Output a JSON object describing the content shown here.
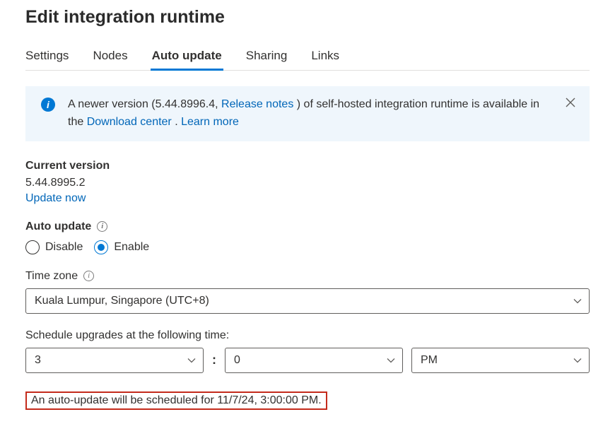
{
  "title": "Edit integration runtime",
  "tabs": [
    {
      "label": "Settings"
    },
    {
      "label": "Nodes"
    },
    {
      "label": "Auto update",
      "active": true
    },
    {
      "label": "Sharing"
    },
    {
      "label": "Links"
    }
  ],
  "banner": {
    "text_part1": "A newer version (5.44.8996.4, ",
    "release_notes_label": "Release notes",
    "text_part2": " ) of self-hosted integration runtime is available in the ",
    "download_center_label": "Download center",
    "text_part3": " . ",
    "learn_more_label": "Learn more"
  },
  "current_version": {
    "label": "Current version",
    "value": "5.44.8995.2",
    "update_now_label": "Update now"
  },
  "auto_update": {
    "label": "Auto update",
    "disable_label": "Disable",
    "enable_label": "Enable",
    "selected": "enable"
  },
  "timezone": {
    "label": "Time zone",
    "value": "Kuala Lumpur, Singapore (UTC+8)"
  },
  "schedule": {
    "label": "Schedule upgrades at the following time:",
    "hour": "3",
    "minute": "0",
    "ampm": "PM",
    "colon": ":"
  },
  "schedule_note": "An auto-update will be scheduled for 11/7/24, 3:00:00 PM."
}
